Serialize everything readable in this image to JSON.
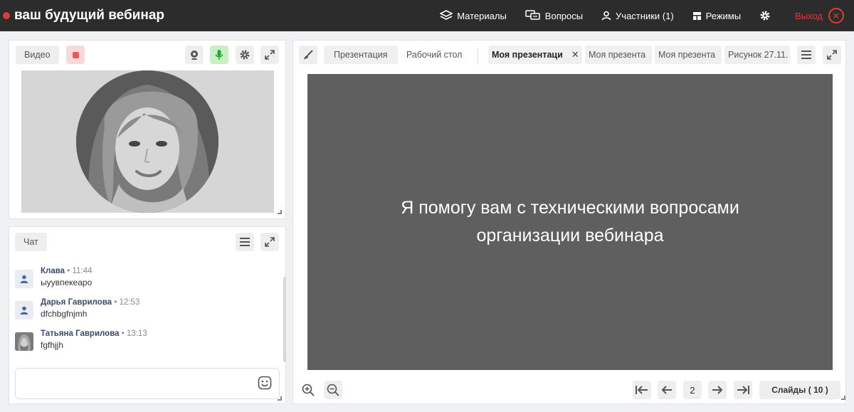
{
  "header": {
    "title": "ваш будущий вебинар",
    "nav": {
      "materials": "Материалы",
      "questions": "Вопросы",
      "participants": "Участники (1)",
      "modes": "Режимы",
      "exit": "Выход"
    }
  },
  "video": {
    "label": "Видео"
  },
  "chat": {
    "label": "Чат",
    "messages": [
      {
        "name": "Клава",
        "time": "• 11:44",
        "text": "ыуувпекеаро"
      },
      {
        "name": "Дарья Гаврилова",
        "time": "• 12:53",
        "text": "dfchbgfnjmh"
      },
      {
        "name": "Татьяна Гаврилова",
        "time": "• 13:13",
        "text": "fgfhjjh"
      }
    ],
    "input_placeholder": ""
  },
  "presentation": {
    "tabs": {
      "presentation": "Презентация",
      "desktop": "Рабочий стол"
    },
    "docs": [
      "Моя презентаци",
      "Моя презента",
      "Моя презента",
      "Рисунок 27.11."
    ],
    "slide_text": "Я помогу вам с техническими вопросами организации вебинара",
    "current_page": "2",
    "slides_label": "Слайды (",
    "slides_count": "10",
    "slides_close": ")"
  }
}
